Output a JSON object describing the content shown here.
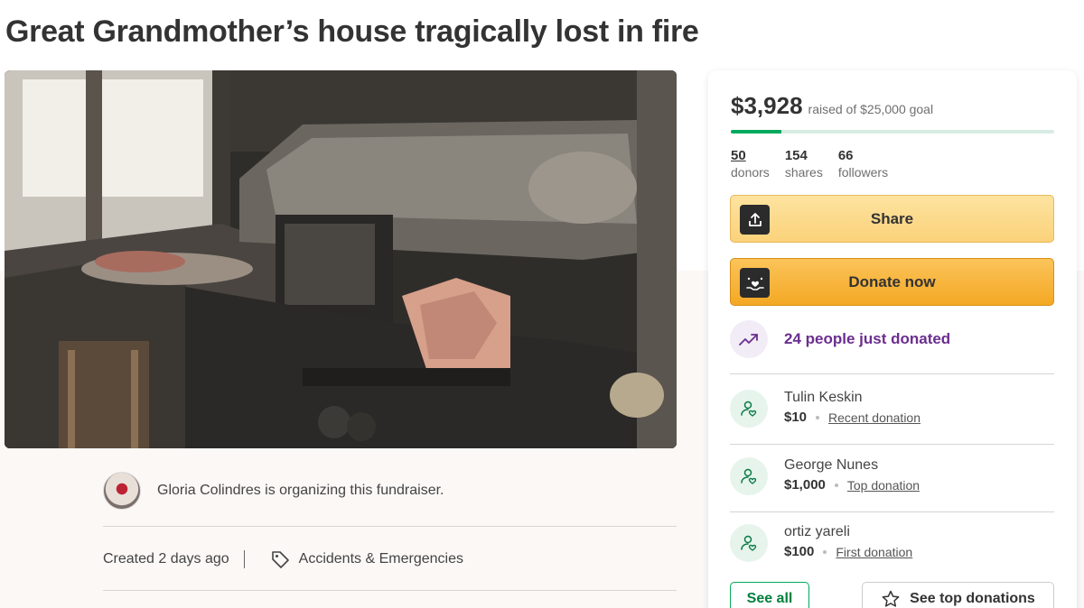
{
  "page_title": "Great Grandmother’s house tragically lost in fire",
  "hero_image_alt": "Fire-damaged kitchen",
  "organizer": {
    "text": "Gloria Colindres is organizing this fundraiser."
  },
  "meta": {
    "created": "Created 2 days ago",
    "category": "Accidents & Emergencies"
  },
  "card": {
    "raised_amount": "$3,928",
    "goal_text": "raised of $25,000 goal",
    "progress_fraction": 0.157,
    "stats": [
      {
        "value": "50",
        "label": "donors"
      },
      {
        "value": "154",
        "label": "shares"
      },
      {
        "value": "66",
        "label": "followers"
      }
    ],
    "share_label": "Share",
    "donate_label": "Donate now",
    "trend_text": "24 people just donated",
    "donations": [
      {
        "name": "Tulin Keskin",
        "amount": "$10",
        "type": "Recent donation"
      },
      {
        "name": "George Nunes",
        "amount": "$1,000",
        "type": "Top donation"
      },
      {
        "name": "ortiz yareli",
        "amount": "$100",
        "type": "First donation"
      }
    ],
    "see_all_label": "See all",
    "see_top_label": "See top donations"
  },
  "colors": {
    "brand_green": "#02a95c",
    "trend_purple": "#6b2d8f",
    "donate_orange": "#f4a824",
    "share_yellow": "#fbd27a"
  },
  "icons": {
    "share": "upload-icon",
    "donate": "heart-hand-icon",
    "trend": "trending-up-icon",
    "donor": "donor-heart-icon",
    "tag": "tag-icon",
    "star": "star-icon"
  }
}
